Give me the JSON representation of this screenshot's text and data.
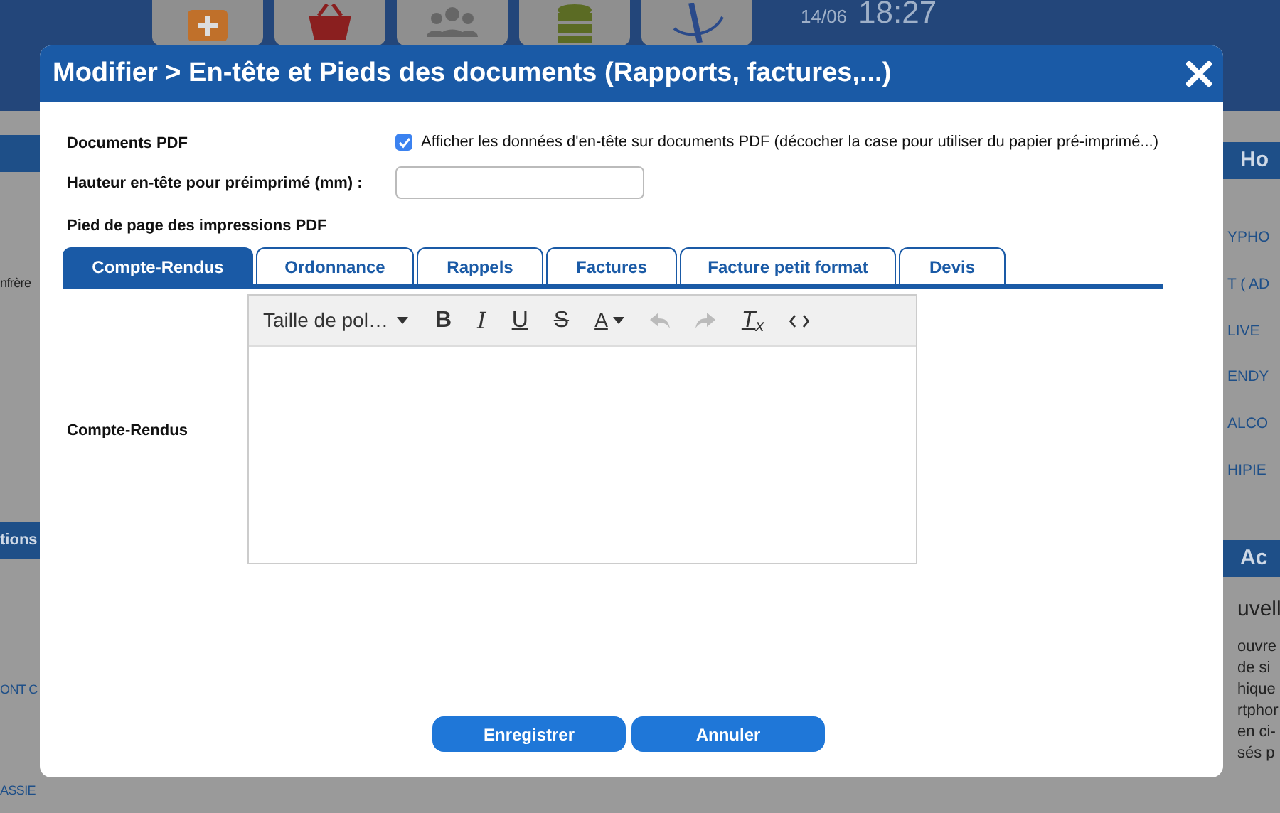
{
  "background": {
    "date": "14/06",
    "time": "18:27",
    "left_panel": {
      "note": "nfrère",
      "section_header": "tions",
      "items": [
        "ONT C",
        "ASSIE"
      ]
    },
    "right_panel": {
      "header": "Ho",
      "items": [
        "YPHO",
        "T ( AD",
        "LIVE",
        "ENDY",
        "ALCO",
        "HIPIE"
      ],
      "section_header": "Ac",
      "title": "uvell",
      "paragraph_lines": [
        "ouvre",
        "de si",
        "hique",
        "rtphor",
        "en ci-",
        "sés p"
      ]
    }
  },
  "dialog": {
    "title": "Modifier > En-tête et Pieds des documents (Rapports, factures,...)",
    "documents_pdf": {
      "label": "Documents PDF",
      "checkbox": {
        "label": "Afficher les données d'en-tête sur documents PDF (décocher la case pour utiliser du papier pré-imprimé...)",
        "checked": true
      }
    },
    "header_height": {
      "label": "Hauteur en-tête pour préimprimé (mm) :"
    },
    "footer_section": {
      "label": "Pied de page des impressions PDF"
    },
    "tabs": [
      {
        "label": "Compte-Rendus",
        "selected": true
      },
      {
        "label": "Ordonnance",
        "selected": false
      },
      {
        "label": "Rappels",
        "selected": false
      },
      {
        "label": "Factures",
        "selected": false
      },
      {
        "label": "Facture petit format",
        "selected": false
      },
      {
        "label": "Devis",
        "selected": false
      }
    ],
    "editor": {
      "label": "Compte-Rendus",
      "font_size": "Taille de pol…",
      "tools": [
        {
          "kind": "bold",
          "label": "B",
          "disabled": false
        },
        {
          "kind": "italic",
          "label": "I",
          "disabled": false
        },
        {
          "kind": "underline",
          "label": "U",
          "disabled": false
        },
        {
          "kind": "strike",
          "label": "S",
          "disabled": false
        },
        {
          "kind": "color",
          "label": "A",
          "disabled": false
        },
        {
          "kind": "undo",
          "disabled": true
        },
        {
          "kind": "redo",
          "disabled": true
        },
        {
          "kind": "clear",
          "label": "T$_{x}$",
          "disabled": false
        },
        {
          "kind": "code",
          "disabled": false
        }
      ]
    },
    "buttons": [
      "Enregistrer",
      "Annuler"
    ]
  }
}
